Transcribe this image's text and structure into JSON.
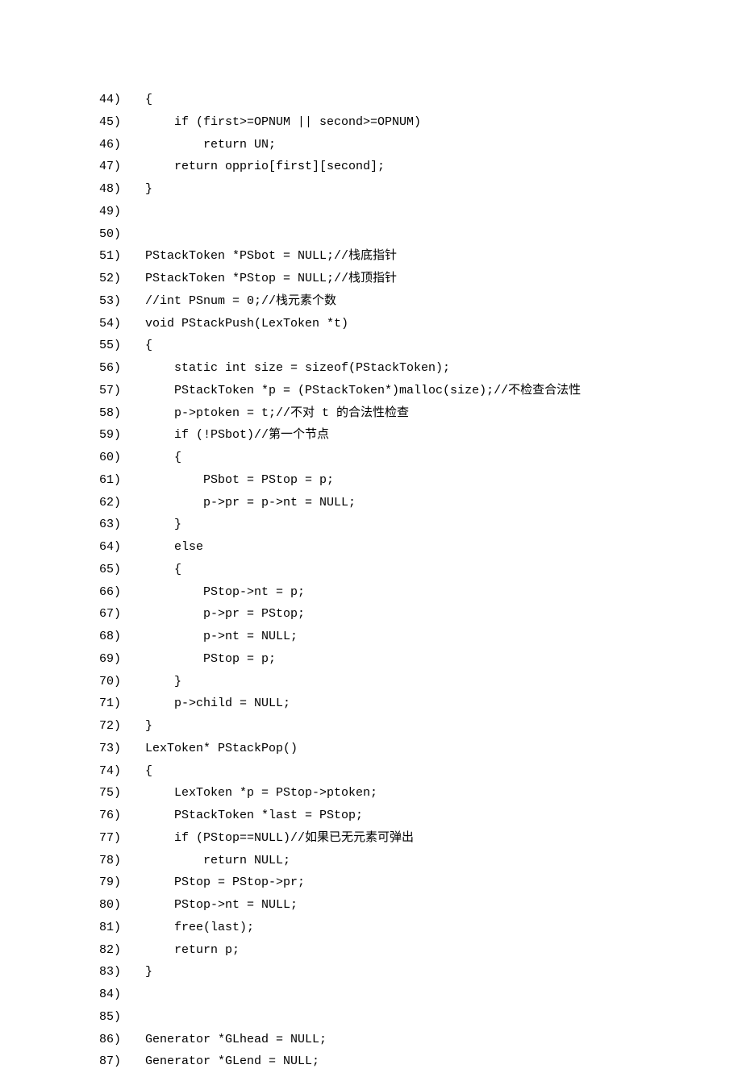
{
  "lines": [
    {
      "n": "44)",
      "c": "{"
    },
    {
      "n": "45)",
      "c": "    if (first>=OPNUM || second>=OPNUM)"
    },
    {
      "n": "46)",
      "c": "        return UN;"
    },
    {
      "n": "47)",
      "c": "    return opprio[first][second];"
    },
    {
      "n": "48)",
      "c": "}"
    },
    {
      "n": "49)",
      "c": ""
    },
    {
      "n": "50)",
      "c": ""
    },
    {
      "n": "51)",
      "c": "PStackToken *PSbot = NULL;//栈底指针"
    },
    {
      "n": "52)",
      "c": "PStackToken *PStop = NULL;//栈顶指针"
    },
    {
      "n": "53)",
      "c": "//int PSnum = 0;//栈元素个数"
    },
    {
      "n": "54)",
      "c": "void PStackPush(LexToken *t)"
    },
    {
      "n": "55)",
      "c": "{"
    },
    {
      "n": "56)",
      "c": "    static int size = sizeof(PStackToken);"
    },
    {
      "n": "57)",
      "c": "    PStackToken *p = (PStackToken*)malloc(size);//不检查合法性"
    },
    {
      "n": "58)",
      "c": "    p->ptoken = t;//不对 t 的合法性检查"
    },
    {
      "n": "59)",
      "c": "    if (!PSbot)//第一个节点"
    },
    {
      "n": "60)",
      "c": "    {"
    },
    {
      "n": "61)",
      "c": "        PSbot = PStop = p;"
    },
    {
      "n": "62)",
      "c": "        p->pr = p->nt = NULL;"
    },
    {
      "n": "63)",
      "c": "    }"
    },
    {
      "n": "64)",
      "c": "    else"
    },
    {
      "n": "65)",
      "c": "    {"
    },
    {
      "n": "66)",
      "c": "        PStop->nt = p;"
    },
    {
      "n": "67)",
      "c": "        p->pr = PStop;"
    },
    {
      "n": "68)",
      "c": "        p->nt = NULL;"
    },
    {
      "n": "69)",
      "c": "        PStop = p;"
    },
    {
      "n": "70)",
      "c": "    }"
    },
    {
      "n": "71)",
      "c": "    p->child = NULL;"
    },
    {
      "n": "72)",
      "c": "}"
    },
    {
      "n": "73)",
      "c": "LexToken* PStackPop()"
    },
    {
      "n": "74)",
      "c": "{"
    },
    {
      "n": "75)",
      "c": "    LexToken *p = PStop->ptoken;"
    },
    {
      "n": "76)",
      "c": "    PStackToken *last = PStop;"
    },
    {
      "n": "77)",
      "c": "    if (PStop==NULL)//如果已无元素可弹出"
    },
    {
      "n": "78)",
      "c": "        return NULL;"
    },
    {
      "n": "79)",
      "c": "    PStop = PStop->pr;"
    },
    {
      "n": "80)",
      "c": "    PStop->nt = NULL;"
    },
    {
      "n": "81)",
      "c": "    free(last);"
    },
    {
      "n": "82)",
      "c": "    return p;"
    },
    {
      "n": "83)",
      "c": "}"
    },
    {
      "n": "84)",
      "c": ""
    },
    {
      "n": "85)",
      "c": ""
    },
    {
      "n": "86)",
      "c": "Generator *GLhead = NULL;"
    },
    {
      "n": "87)",
      "c": "Generator *GLend = NULL;"
    }
  ]
}
